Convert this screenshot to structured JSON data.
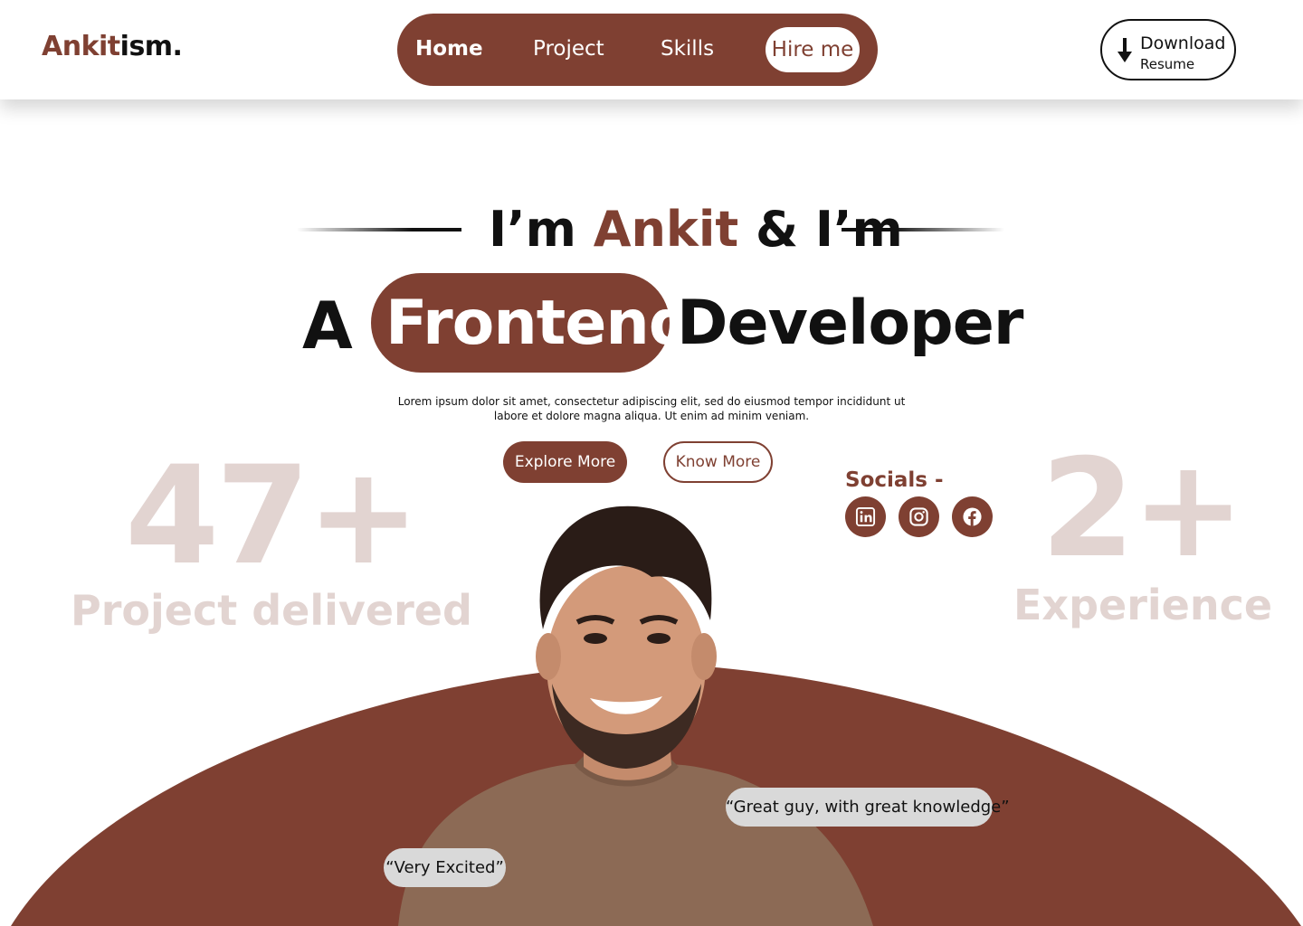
{
  "header": {
    "logo_part1": "Ankit",
    "logo_part2": "ism.",
    "nav": {
      "home": "Home",
      "project": "Project",
      "skills": "Skills",
      "hire": "Hire me"
    },
    "download": {
      "line1": "Download",
      "line2": "Resume",
      "icon": "arrow-down-icon"
    }
  },
  "hero": {
    "intro_prefix": "I’m ",
    "intro_name": "Ankit",
    "intro_suffix": " & I’m",
    "role_prefix": "A",
    "role_highlight": "Frontend",
    "role_suffix": "Developer",
    "description": "Lorem ipsum dolor sit amet, consectetur adipiscing elit, sed do eiusmod tempor incididunt ut labore et dolore magna aliqua. Ut enim ad minim veniam.",
    "buttons": {
      "explore": "Explore More",
      "know": "Know More"
    }
  },
  "stats": {
    "projects_value": "47+",
    "projects_label": "Project delivered",
    "experience_value": "2+",
    "experience_label": "Experience"
  },
  "socials": {
    "title": "Socials -",
    "icons": [
      "linkedin-icon",
      "instagram-icon",
      "facebook-icon"
    ]
  },
  "testimonials": {
    "quote1": "“Great guy, with great knowledge”",
    "quote2": "“Very Excited”"
  },
  "colors": {
    "brand": "#7f4032",
    "stat_text": "#e2d4d1",
    "bubble": "#d9d9d9"
  }
}
